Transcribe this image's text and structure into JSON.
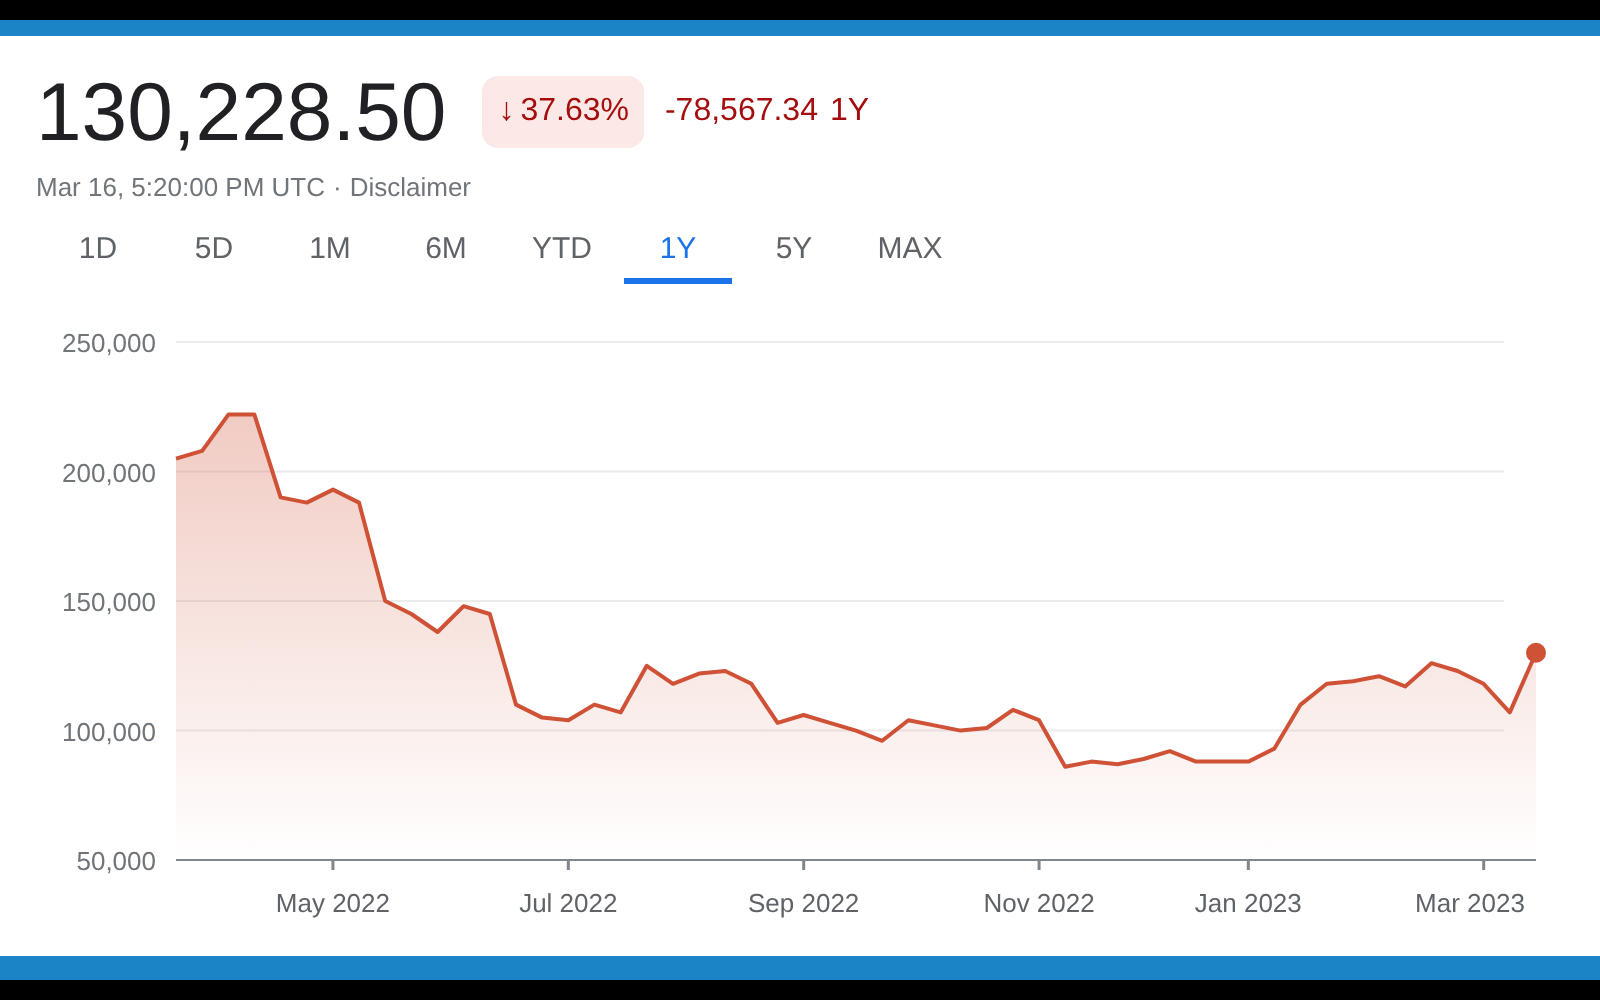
{
  "quote": {
    "price": "130,228.50",
    "arrow": "↓",
    "change_percent": "37.63%",
    "change": "-78,567.34",
    "period": "1Y",
    "timestamp": "Mar 16, 5:20:00 PM UTC",
    "separator": "·",
    "disclaimer": "Disclaimer"
  },
  "range_tabs": [
    {
      "label": "1D",
      "selected": false
    },
    {
      "label": "5D",
      "selected": false
    },
    {
      "label": "1M",
      "selected": false
    },
    {
      "label": "6M",
      "selected": false
    },
    {
      "label": "YTD",
      "selected": false
    },
    {
      "label": "1Y",
      "selected": true
    },
    {
      "label": "5Y",
      "selected": false
    },
    {
      "label": "MAX",
      "selected": false
    }
  ],
  "chart": {
    "chart_data": {
      "type": "area",
      "categories": [
        null,
        null,
        null,
        null,
        null,
        null,
        "May 2022",
        null,
        null,
        null,
        null,
        null,
        null,
        null,
        null,
        "Jul 2022",
        null,
        null,
        null,
        null,
        null,
        null,
        null,
        null,
        "Sep 2022",
        null,
        null,
        null,
        null,
        null,
        null,
        null,
        null,
        "Nov 2022",
        null,
        null,
        null,
        null,
        null,
        null,
        null,
        "Jan 2023",
        null,
        null,
        null,
        null,
        null,
        null,
        null,
        null,
        "Mar 2023",
        null,
        null
      ],
      "values": [
        205000,
        208000,
        222000,
        222000,
        190000,
        188000,
        193000,
        188000,
        150000,
        145000,
        138000,
        148000,
        145000,
        110000,
        105000,
        104000,
        110000,
        107000,
        125000,
        118000,
        122000,
        123000,
        118000,
        103000,
        106000,
        103000,
        100000,
        96000,
        104000,
        102000,
        100000,
        101000,
        108000,
        104000,
        86000,
        88000,
        87000,
        89000,
        92000,
        88000,
        88000,
        88000,
        93000,
        110000,
        118000,
        119000,
        121000,
        117000,
        126000,
        123000,
        118000,
        107000,
        130000
      ],
      "ylim": [
        50000,
        250000
      ],
      "grid": true,
      "yticks": [
        {
          "value": 50000,
          "label": "50,000"
        },
        {
          "value": 100000,
          "label": "100,000"
        },
        {
          "value": 150000,
          "label": "150,000"
        },
        {
          "value": 200000,
          "label": "200,000"
        },
        {
          "value": 250000,
          "label": "250,000"
        }
      ]
    }
  }
}
